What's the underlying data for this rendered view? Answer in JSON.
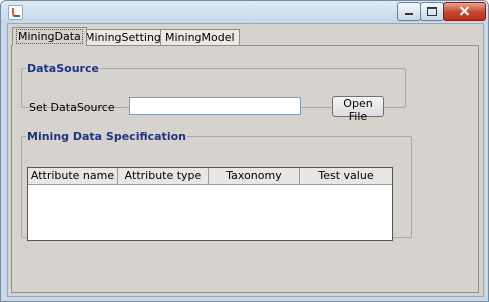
{
  "tabs": [
    {
      "label": "MiningData"
    },
    {
      "label": "MiningSetting"
    },
    {
      "label": "MiningModel"
    }
  ],
  "datasource": {
    "title": "DataSource",
    "label": "Set DataSource",
    "value": "",
    "button": "Open File"
  },
  "spec": {
    "title": "Mining Data Specification",
    "columns": [
      "Attribute name",
      "Attribute type",
      "Taxonomy",
      "Test value"
    ]
  },
  "icons": {
    "app": "java-icon",
    "minimize": "minimize-icon",
    "maximize": "maximize-icon",
    "close": "close-icon"
  }
}
